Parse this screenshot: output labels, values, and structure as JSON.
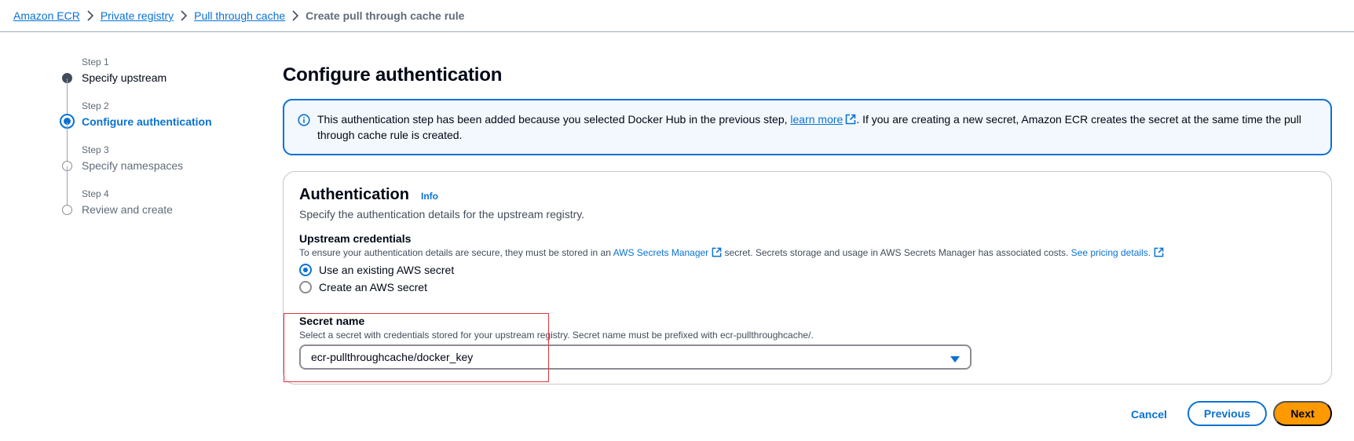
{
  "breadcrumb": {
    "items": [
      "Amazon ECR",
      "Private registry",
      "Pull through cache"
    ],
    "current": "Create pull through cache rule"
  },
  "steps": [
    {
      "number": "Step 1",
      "title": "Specify upstream",
      "state": "done"
    },
    {
      "number": "Step 2",
      "title": "Configure authentication",
      "state": "active"
    },
    {
      "number": "Step 3",
      "title": "Specify namespaces",
      "state": "pending"
    },
    {
      "number": "Step 4",
      "title": "Review and create",
      "state": "pending"
    }
  ],
  "page_title": "Configure authentication",
  "alert": {
    "text_before": "This authentication step has been added because you selected Docker Hub in the previous step, ",
    "link": "learn more",
    "text_after": ". If you are creating a new secret, Amazon ECR creates the secret at the same time the pull through cache rule is created."
  },
  "auth": {
    "title": "Authentication",
    "info": "Info",
    "description": "Specify the authentication details for the upstream registry.",
    "credentials_label": "Upstream credentials",
    "credentials_desc_before": "To ensure your authentication details are secure, they must be stored in an ",
    "secrets_manager_link": "AWS Secrets Manager",
    "credentials_desc_after": " secret. Secrets storage and usage in AWS Secrets Manager has associated costs. ",
    "pricing_link": "See pricing details.",
    "options": [
      {
        "label": "Use an existing AWS secret",
        "checked": true
      },
      {
        "label": "Create an AWS secret",
        "checked": false
      }
    ],
    "secret_label": "Secret name",
    "secret_desc": "Select a secret with credentials stored for your upstream registry. Secret name must be prefixed with ecr-pullthroughcache/.",
    "secret_value": "ecr-pullthroughcache/docker_key"
  },
  "footer": {
    "cancel": "Cancel",
    "previous": "Previous",
    "next": "Next"
  },
  "colors": {
    "link": "#0972d3",
    "primary_button": "#ff9900",
    "alert_bg": "#f2f8fd",
    "highlight": "#e0353b"
  }
}
